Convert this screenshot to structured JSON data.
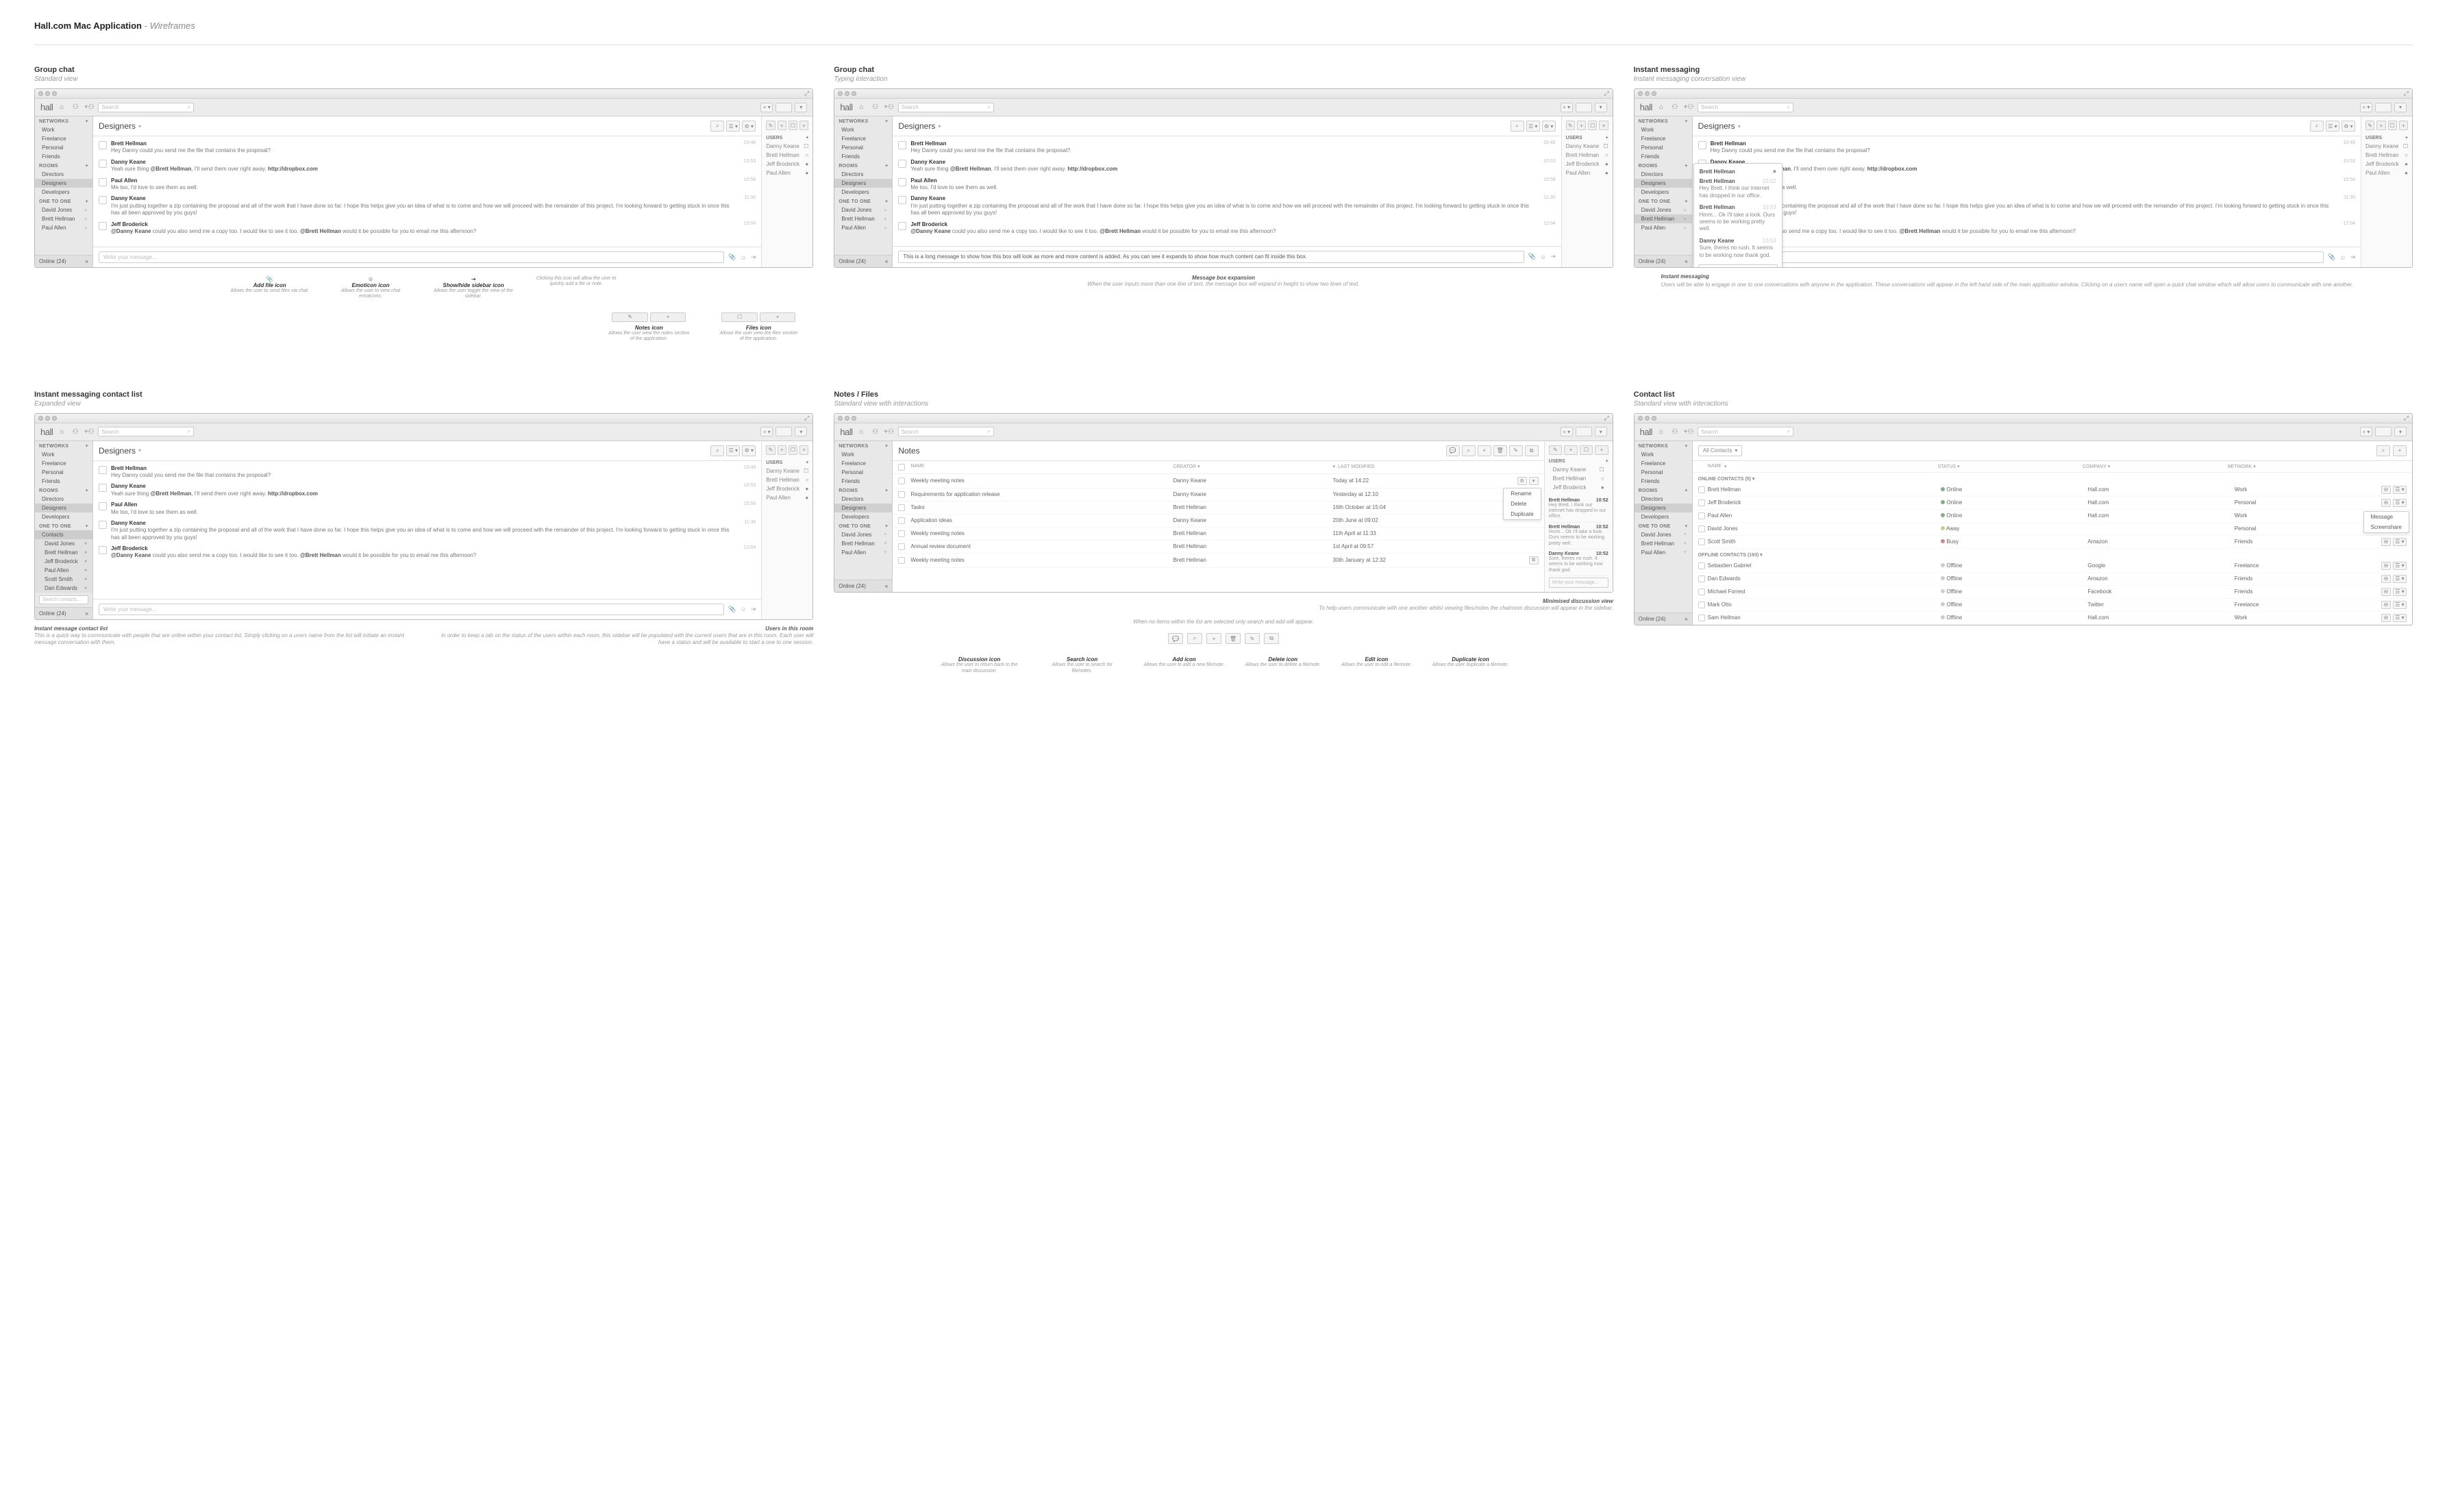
{
  "page_title_bold": "Hall.com Mac Application",
  "page_title_italic": "- Wireframes",
  "common": {
    "logo": "hall",
    "search_placeholder": "Search",
    "write_message": "Write your message...",
    "write_your_message": "Write your message...",
    "online_status": "Online",
    "online_count": "(24)"
  },
  "sidebar": {
    "networks_hdr": "Networks",
    "networks": [
      "Work",
      "Freelance",
      "Personal",
      "Friends"
    ],
    "rooms_hdr": "Rooms",
    "rooms": [
      "Directors",
      "Designers",
      "Developers"
    ],
    "one_hdr": "One to one",
    "one": [
      "David Jones",
      "Brett Hellman",
      "Paul Allen"
    ],
    "contacts_hdr": "Contacts",
    "contact_sublist": [
      "David Jones",
      "Brett Hellman",
      "Jeff Broderick",
      "Paul Allen",
      "Scott Smith",
      "Dan Edwards"
    ],
    "search_contacts": "Search contacts..."
  },
  "chat": {
    "room_title": "Designers",
    "messages": [
      {
        "name": "Brett Hellman",
        "text": "Hey Danny could you send me the file that contains the proposal?",
        "time": "10:46"
      },
      {
        "name": "Danny Keane",
        "text": "Yeah sure thing @Brett Hellman, I'll send them over right away. http://dropbox.com",
        "time": "10:53"
      },
      {
        "name": "Paul Allen",
        "text": "Me too, I'd love to see them as well.",
        "time": "10:56"
      },
      {
        "name": "Danny Keane",
        "text": "I'm just putting together a zip containing the proposal and all of the work that I have done so far. I hope this helps give you an idea of what is to come and how we will proceed with the remainder of this project. I'm looking forward to getting stuck in once this has all been approved by you guys!",
        "time": "11:30"
      },
      {
        "name": "Jeff Broderick",
        "text": "@Danny Keane could you also send me a copy too. I would like to see it too. @Brett Hellman would it be possible for you to email me this afternoon?",
        "time": "12:04"
      }
    ],
    "side_users_hdr": "Users",
    "side_users": [
      "Danny Keane",
      "Brett Hellman",
      "Jeff Broderick",
      "Paul Allen"
    ],
    "side_user_icons": [
      "☐",
      "○",
      "●",
      "●"
    ]
  },
  "wf1": {
    "title": "Group chat",
    "sub": "Standard view",
    "annot_addfile_t": "Add file icon",
    "annot_addfile_d": "Allows the user to send files via chat.",
    "annot_emoticon_t": "Emoticon icon",
    "annot_emoticon_d": "Allows the user to view chat emoticons.",
    "annot_showhide_t": "Show/hide sidebar icon",
    "annot_showhide_d": "Allows the user toggle the view of the sidebar.",
    "annot_click_note": "Clicking this icon will allow the user to quickly add a file or note.",
    "annot_notes_t": "Notes icon",
    "annot_notes_d": "Allows the user view the notes section of the application.",
    "annot_files_t": "Files icon",
    "annot_files_d": "Allows the user view the files section of the application."
  },
  "wf2": {
    "title": "Group chat",
    "sub": "Typing interaction",
    "long_msg": "This is a long message to show how this box will look as more and more content is added. As you can see it expands to show how much content can fit inside this box.",
    "annot_t": "Message box expansion",
    "annot_d": "When the user inputs more than one line of text, the message box will expand in height to show two lines of text."
  },
  "wf3": {
    "title": "Instant messaging",
    "sub": "Instant messaging conversation view",
    "popover_hdr": "Brett Hellman",
    "pm": [
      {
        "n": "Brett Hellman",
        "t": "Hey Brett, I think our internet has dropped in our office.",
        "tm": "10:52"
      },
      {
        "n": "Brett Hellman",
        "t": "Hmm... Ok I'll take a look. Ours seems to be working pretty well.",
        "tm": "10:53"
      },
      {
        "n": "Danny Keane",
        "t": "Sure, theres no rush. It seems to be working now thank god.",
        "tm": "10:53"
      }
    ],
    "annot_t": "Instant messaging",
    "annot_d": "Users will be able to engage in one to one conversations with anyone in the application. These conversations will appear in the left hand side of the main application window. Clicking on a users name will open a quick chat window which will allow users to communicate with one another."
  },
  "wf4": {
    "title": "Instant messaging contact list",
    "sub": "Expanded view",
    "annot_l_t": "Instant message contact list",
    "annot_l_d": "This is a quick way to communicate with people that are online within your contact list. Simply clicking on a users name from the list will initiate an instant message conversation with them.",
    "annot_r_t": "Users in this room",
    "annot_r_d": "In order to keep a tab on the status of the users within each room, this sidebar will be populated with the current users that are in this room. Each user will have a status and will be available to start a one to one session."
  },
  "wf5": {
    "title": "Notes / Files",
    "sub": "Standard view with interactions",
    "notes_title": "Notes",
    "cols": {
      "name": "Name",
      "creator": "Creator",
      "modified": "Last Modified"
    },
    "rows": [
      {
        "name": "Weekly meeting notes",
        "creator": "Danny Keane",
        "modified": "Today at 14:22"
      },
      {
        "name": "Requirements for application release",
        "creator": "Danny Keane",
        "modified": "Yesterday at 12:10"
      },
      {
        "name": "Tasks",
        "creator": "Brett Hellman",
        "modified": "16th October at 15:04"
      },
      {
        "name": "Application ideas",
        "creator": "Danny Keane",
        "modified": "20th June at 09:02"
      },
      {
        "name": "Weekly meeting notes",
        "creator": "Brett Hellman",
        "modified": "11th April at 11:33"
      },
      {
        "name": "Annual review document",
        "creator": "Brett Hellman",
        "modified": "1st April at 09:57"
      },
      {
        "name": "Weekly meeting notes",
        "creator": "Brett Hellman",
        "modified": "30th January at 12:32"
      }
    ],
    "ctx": [
      "Rename",
      "Delete",
      "Duplicate"
    ],
    "chat_mini": [
      {
        "n": "Brett Hellman",
        "t": "Hey Brett, I think our internet has dropped in our office.",
        "tm": "10:52"
      },
      {
        "n": "Brett Hellman",
        "t": "Hmm... Ok I'll take a look. Ours seems to be working pretty well.",
        "tm": "10:52"
      },
      {
        "n": "Danny Keane",
        "t": "Sure, theres no rush. It seems to be working now thank god.",
        "tm": "10:52"
      }
    ],
    "annot_r_t": "Minimised discussion view",
    "annot_r_d": "To help users communicate with one another whilst viewing files/notes the chatroom discussion will appear in the sidebar.",
    "mid_note_d": "When no items within the list are selected only search and add will appear.",
    "icons": [
      {
        "t": "Discussion icon",
        "d": "Allows the user to return back to the main discussion."
      },
      {
        "t": "Search icon",
        "d": "Allows the user to search for file/notes."
      },
      {
        "t": "Add icon",
        "d": "Allows the user to add a new file/note."
      },
      {
        "t": "Delete icon",
        "d": "Allows the user to delete a file/note."
      },
      {
        "t": "Edit icon",
        "d": "Allows the user to edit a file/note."
      },
      {
        "t": "Duplicate icon",
        "d": "Allows the user duplicate a file/note."
      }
    ]
  },
  "wf6": {
    "title": "Contact list",
    "sub": "Standard view with interactions",
    "filter_all": "All Contacts",
    "cols": {
      "name": "Name",
      "status": "Status",
      "company": "Company",
      "network": "Network"
    },
    "online_hdr": "Online Contacts",
    "online_count": "(5)",
    "offline_hdr": "Offline Contacts",
    "offline_count": "(193)",
    "online": [
      {
        "n": "Brett Hellman",
        "s": "Online",
        "c": "Hall.com",
        "nw": "Work"
      },
      {
        "n": "Jeff Broderick",
        "s": "Online",
        "c": "Hall.com",
        "nw": "Personal"
      },
      {
        "n": "Paul Allen",
        "s": "Online",
        "c": "Hall.com",
        "nw": "Work"
      },
      {
        "n": "David Jones",
        "s": "Away",
        "c": "",
        "nw": "Personal"
      },
      {
        "n": "Scott Smith",
        "s": "Busy",
        "c": "Amazon",
        "nw": "Friends"
      }
    ],
    "offline": [
      {
        "n": "Sebastien Gabriel",
        "s": "Offline",
        "c": "Google",
        "nw": "Freelance"
      },
      {
        "n": "Dan Edwards",
        "s": "Offline",
        "c": "Amazon",
        "nw": "Friends"
      },
      {
        "n": "Michael Forrest",
        "s": "Offline",
        "c": "Facebook",
        "nw": "Friends"
      },
      {
        "n": "Mark Otto",
        "s": "Offline",
        "c": "Twitter",
        "nw": "Freelance"
      },
      {
        "n": "Sam Hellman",
        "s": "Offline",
        "c": "Hall.com",
        "nw": "Work"
      }
    ],
    "ctx": [
      "Message",
      "Screenshare"
    ]
  }
}
